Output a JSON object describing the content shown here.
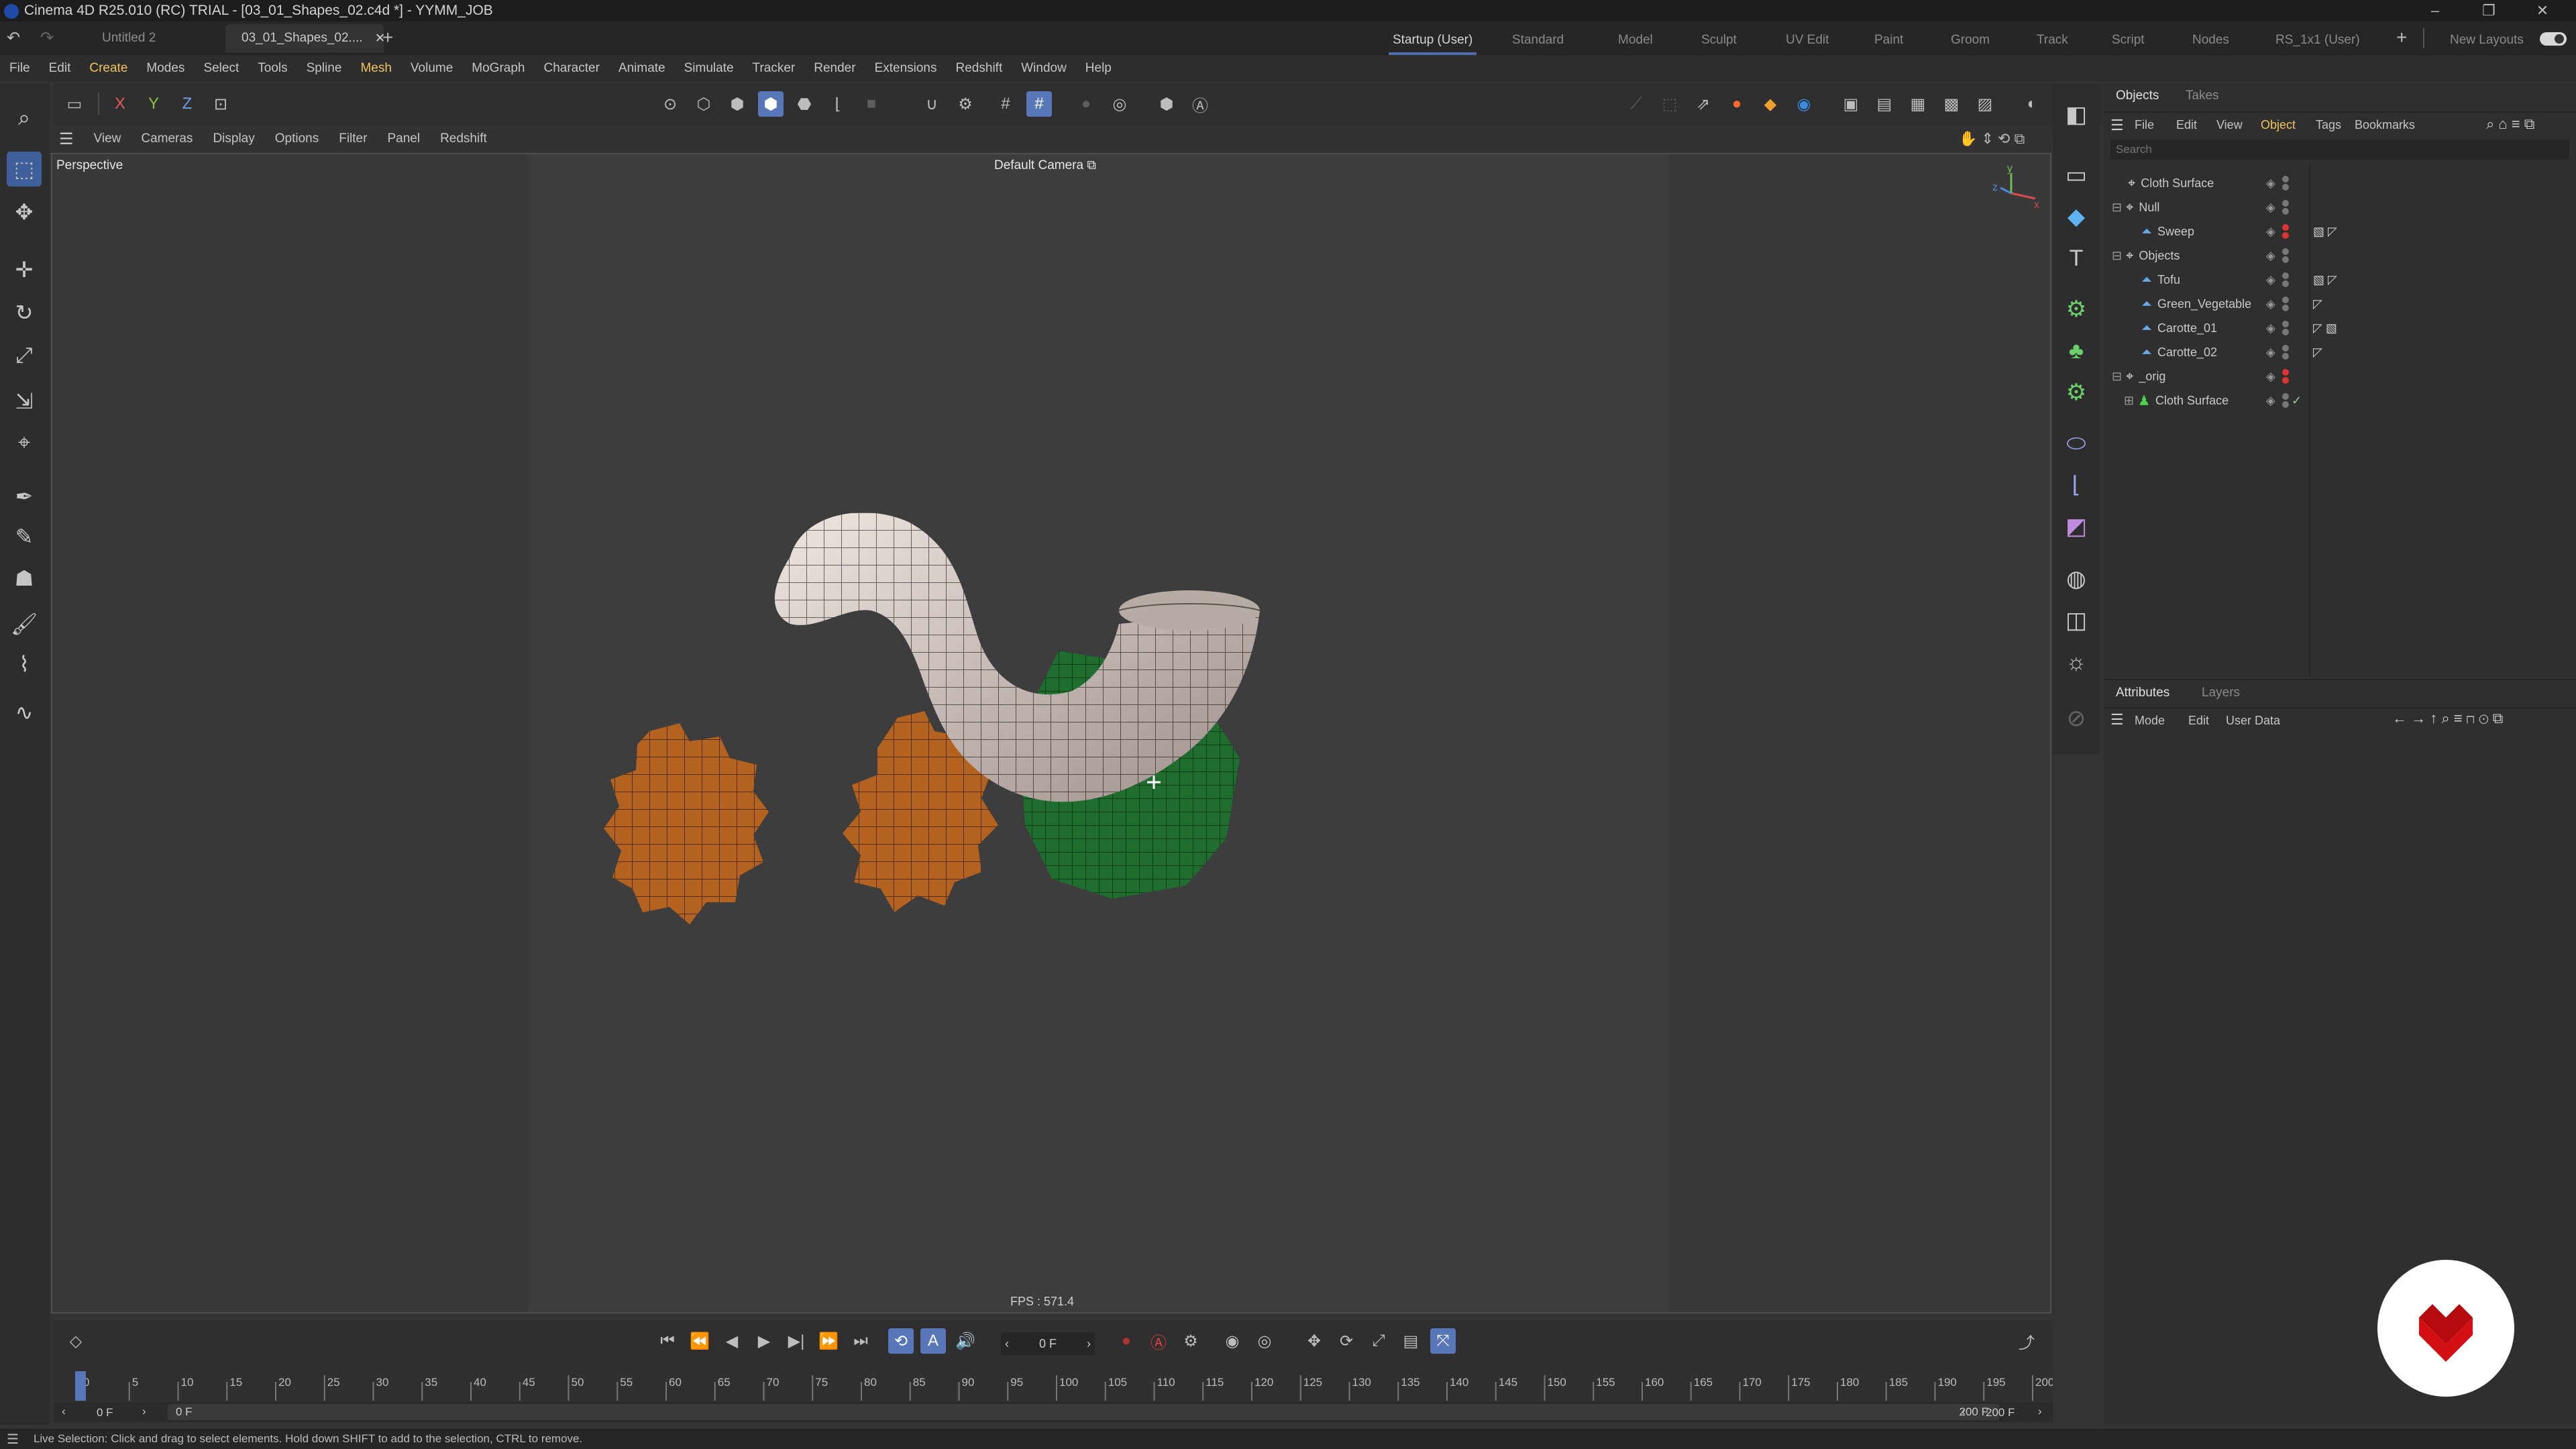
{
  "window": {
    "title": "Cinema 4D R25.010 (RC) TRIAL - [03_01_Shapes_02.c4d *] - YYMM_JOB"
  },
  "doc_tabs": [
    {
      "label": "Untitled 2"
    },
    {
      "label": "03_01_Shapes_02...."
    }
  ],
  "layouts": [
    "Startup (User)",
    "Standard",
    "Model",
    "Sculpt",
    "UV Edit",
    "Paint",
    "Groom",
    "Track",
    "Script",
    "Nodes",
    "RS_1x1 (User)"
  ],
  "active_layout": "Startup (User)",
  "new_layouts_label": "New Layouts",
  "menu": [
    "File",
    "Edit",
    "Create",
    "Modes",
    "Select",
    "Tools",
    "Spline",
    "Mesh",
    "Volume",
    "MoGraph",
    "Character",
    "Animate",
    "Simulate",
    "Tracker",
    "Render",
    "Extensions",
    "Redshift",
    "Window",
    "Help"
  ],
  "axis_toggles": [
    "X",
    "Y",
    "Z"
  ],
  "viewport": {
    "menu": [
      "View",
      "Cameras",
      "Display",
      "Options",
      "Filter",
      "Panel",
      "Redshift"
    ],
    "projection": "Perspective",
    "camera": "Default Camera",
    "fps": "FPS : 571.4"
  },
  "objects_panel": {
    "tabs": [
      "Objects",
      "Takes"
    ],
    "menu": [
      "File",
      "Edit",
      "View",
      "Object",
      "Tags",
      "Bookmarks"
    ],
    "search_placeholder": "Search",
    "tree": [
      {
        "name": "Cloth Surface",
        "depth": 0,
        "type": "null"
      },
      {
        "name": "Null",
        "depth": 0,
        "type": "null"
      },
      {
        "name": "Sweep",
        "depth": 1,
        "type": "poly"
      },
      {
        "name": "Objects",
        "depth": 0,
        "type": "null"
      },
      {
        "name": "Tofu",
        "depth": 1,
        "type": "poly"
      },
      {
        "name": "Green_Vegetable",
        "depth": 1,
        "type": "poly"
      },
      {
        "name": "Carotte_01",
        "depth": 1,
        "type": "poly"
      },
      {
        "name": "Carotte_02",
        "depth": 1,
        "type": "poly"
      },
      {
        "name": "_orig",
        "depth": 0,
        "type": "null"
      },
      {
        "name": "Cloth Surface",
        "depth": 1,
        "type": "cloth"
      }
    ]
  },
  "attributes_panel": {
    "tabs": [
      "Attributes",
      "Layers"
    ],
    "menu": [
      "Mode",
      "Edit",
      "User Data"
    ]
  },
  "timeline": {
    "current_frame": "0 F",
    "start": "0 F",
    "range_start": "0 F",
    "range_end": "200 F",
    "end": "200 F",
    "ticks": [
      "0",
      "5",
      "10",
      "15",
      "20",
      "25",
      "30",
      "35",
      "40",
      "45",
      "50",
      "55",
      "60",
      "65",
      "70",
      "75",
      "80",
      "85",
      "90",
      "95",
      "100",
      "105",
      "110",
      "115",
      "120",
      "125",
      "130",
      "135",
      "140",
      "145",
      "150",
      "155",
      "160",
      "165",
      "170",
      "175",
      "180",
      "185",
      "190",
      "195",
      "200"
    ]
  },
  "status": {
    "text": "Live Selection: Click and drag to select elements. Hold down SHIFT to add to the selection, CTRL to remove."
  },
  "colors": {
    "accent": "#4e6ea8",
    "carrot": "#b5651d",
    "vegetable": "#1e6b2e",
    "tofu": "#d8cfcb",
    "brand_red": "#d40f14"
  }
}
